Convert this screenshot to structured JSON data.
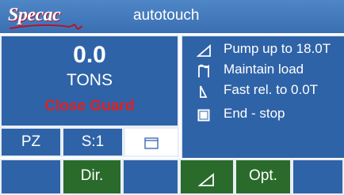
{
  "header": {
    "logo_text": "Specac",
    "title": "autotouch",
    "logo_accent_color": "#b8142b"
  },
  "status": {
    "load_value": "0.0",
    "load_unit": "TONS",
    "warning": "Close Guard",
    "warning_color": "#e02020"
  },
  "program": {
    "steps": [
      {
        "icon": "ramp-up-icon",
        "label": "Pump up to 18.0T"
      },
      {
        "icon": "hold-load-icon",
        "label": "Maintain load"
      },
      {
        "icon": "ramp-down-icon",
        "label": "Fast rel. to 0.0T"
      },
      {
        "icon": "stop-square-icon",
        "label": "End - stop"
      }
    ]
  },
  "modes": {
    "pz_label": "PZ",
    "step_label": "S:1",
    "grip_icon": "die-icon"
  },
  "softkeys": {
    "dir_label": "Dir.",
    "ramp_icon": "ramp-up-icon",
    "opt_label": "Opt."
  },
  "colors": {
    "panel_blue": "#2f63a8",
    "header_blue": "#4a82c4",
    "softkey_green": "#2a6b2c"
  }
}
